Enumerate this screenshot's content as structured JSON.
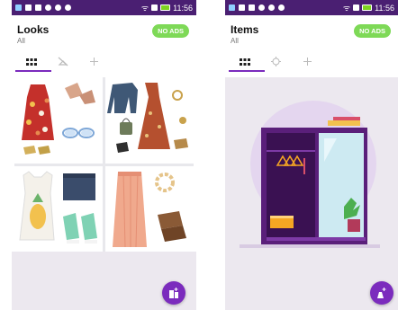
{
  "status": {
    "time": "11:56"
  },
  "looks_screen": {
    "title": "Looks",
    "subtitle": "All",
    "badge": "NO ADS",
    "tabs": [
      {
        "icon": "grid-icon",
        "glyph": "▪▪▪",
        "active": true
      },
      {
        "icon": "hanger-off-icon",
        "glyph": "ᚸ",
        "active": false
      },
      {
        "icon": "plus-icon",
        "glyph": "+",
        "active": false
      }
    ],
    "outfits": [
      {
        "name": "outfit-floral-dress"
      },
      {
        "name": "outfit-denim-jacket"
      },
      {
        "name": "outfit-pineapple-tank"
      },
      {
        "name": "outfit-coral-skirt"
      }
    ],
    "fab_icon": "add-look-icon"
  },
  "items_screen": {
    "title": "Items",
    "subtitle": "All",
    "badge": "NO ADS",
    "tabs": [
      {
        "icon": "grid-icon",
        "glyph": "▪▪▪",
        "active": true
      },
      {
        "icon": "target-icon",
        "glyph": "◎",
        "active": false
      },
      {
        "icon": "plus-icon",
        "glyph": "+",
        "active": false
      }
    ],
    "illustration": "empty-wardrobe-illustration",
    "fab_icon": "add-item-icon"
  },
  "colors": {
    "accent": "#7b2bbd",
    "status_bar": "#4a1f72",
    "badge": "#7ed957"
  }
}
